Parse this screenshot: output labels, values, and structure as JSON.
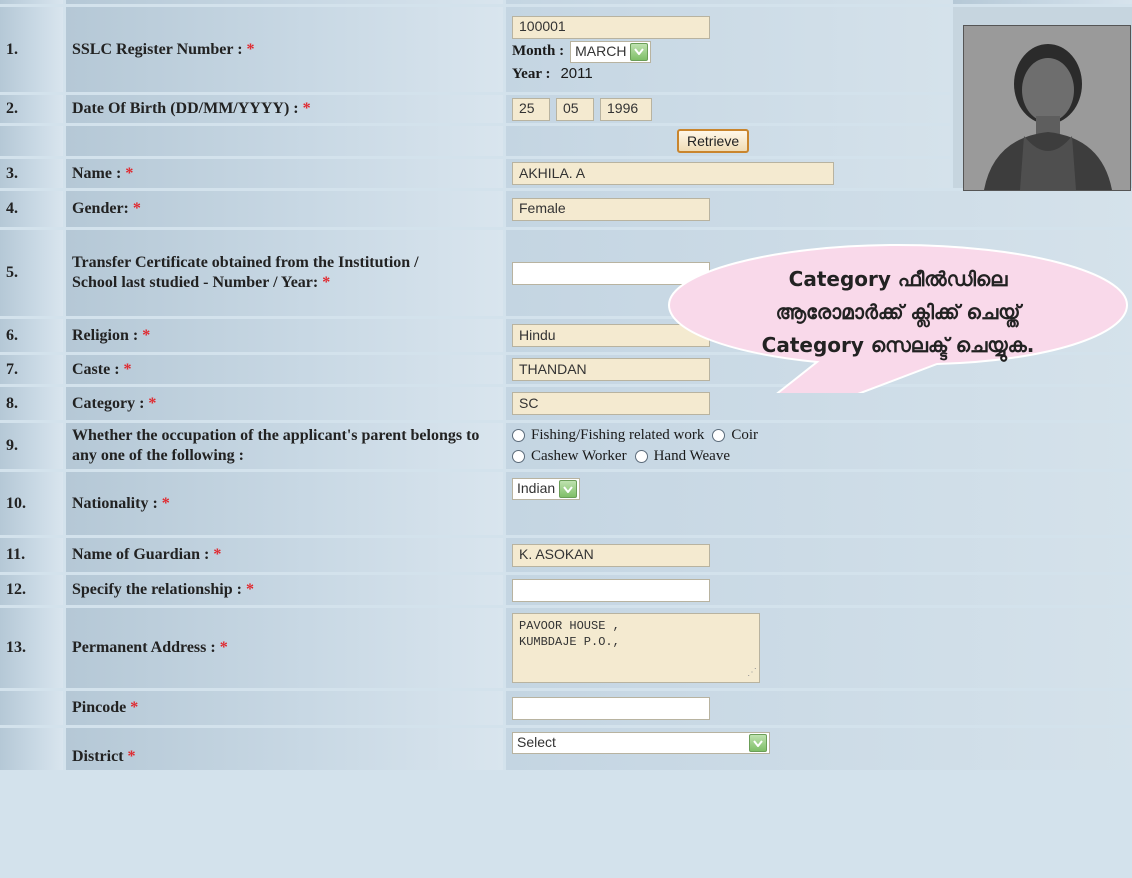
{
  "rows": [
    {
      "num": "1.",
      "label": "SSLC Register Number :",
      "req": "*"
    },
    {
      "num": "2.",
      "label": "Date Of Birth (DD/MM/YYYY) :",
      "req": "*"
    },
    {
      "num": "3.",
      "label": "Name :",
      "req": "*"
    },
    {
      "num": "4.",
      "label": "Gender:",
      "req": "*"
    },
    {
      "num": "5.",
      "label": "Transfer Certificate obtained from the Institution / School last studied - Number / Year:",
      "req": "*"
    },
    {
      "num": "6.",
      "label": "Religion :",
      "req": "*"
    },
    {
      "num": "7.",
      "label": "Caste :",
      "req": "*"
    },
    {
      "num": "8.",
      "label": "Category :",
      "req": "*"
    },
    {
      "num": "9.",
      "label": "Whether the occupation of the applicant's parent belongs to any one of the following :"
    },
    {
      "num": "10.",
      "label": "Nationality :",
      "req": "*"
    },
    {
      "num": "11.",
      "label": "Name of Guardian :",
      "req": "*"
    },
    {
      "num": "12.",
      "label": "Specify the relationship :",
      "req": "*"
    },
    {
      "num": "13.",
      "label": "Permanent Address :",
      "req": "*"
    },
    {
      "num": "",
      "label": "Pincode",
      "req": "*"
    },
    {
      "num": "",
      "label": "District",
      "req": "*"
    }
  ],
  "values": {
    "register_number": "100001",
    "month_label": "Month :",
    "month_value": "MARCH",
    "year_label": "Year :",
    "year_value": "2011",
    "dob_day": "25",
    "dob_month": "05",
    "dob_year": "1996",
    "retrieve_label": "Retrieve",
    "name": "AKHILA. A",
    "gender": "Female",
    "tc_number": "",
    "religion": "Hindu",
    "caste": "THANDAN",
    "category": "SC",
    "occupation_options": [
      "Fishing/Fishing related work",
      "Coir",
      "Cashew Worker",
      "Hand Weave"
    ],
    "nationality": "Indian",
    "guardian": "K. ASOKAN",
    "relationship": "",
    "address_line1": "PAVOOR HOUSE ,",
    "address_line2": "KUMBDAJE P.O.,",
    "pincode": "",
    "district": "Select"
  },
  "callout": {
    "line1": "Category ഫീൽഡിലെ",
    "line2": "ആരോമാർക്ക് ക്ലിക്ക് ചെയ്ത്",
    "line3": "Category സെലക്ട് ചെയ്യുക."
  },
  "colors": {
    "callout_fill": "#f9d9ea",
    "required": "#e0282e",
    "input_readonly": "#f4ead0",
    "button_border": "#c9852d"
  }
}
